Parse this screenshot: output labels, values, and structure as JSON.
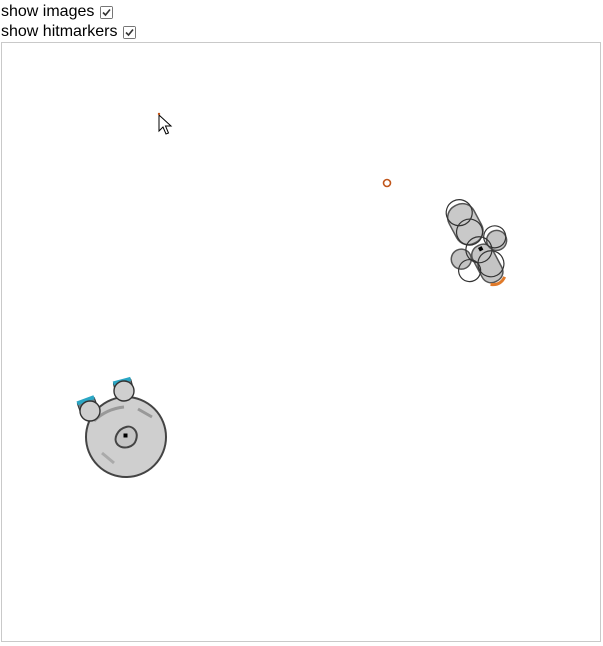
{
  "options": [
    {
      "label": "show images",
      "checked": true
    },
    {
      "label": "show hitmarkers",
      "checked": true
    }
  ],
  "scene": {
    "entities": [
      {
        "kind": "tank",
        "facing": "upper-left",
        "body_color": "#cfcfcf",
        "accent_color": "#2aa6c4"
      },
      {
        "kind": "mech",
        "facing": "down-right",
        "body_color": "#c9c9c9",
        "accent_color": "#e07a2a"
      }
    ],
    "projectile": {
      "kind": "shell",
      "color": "#c0551a"
    },
    "cursor": {
      "icon": "pointer-arrow-icon"
    }
  }
}
